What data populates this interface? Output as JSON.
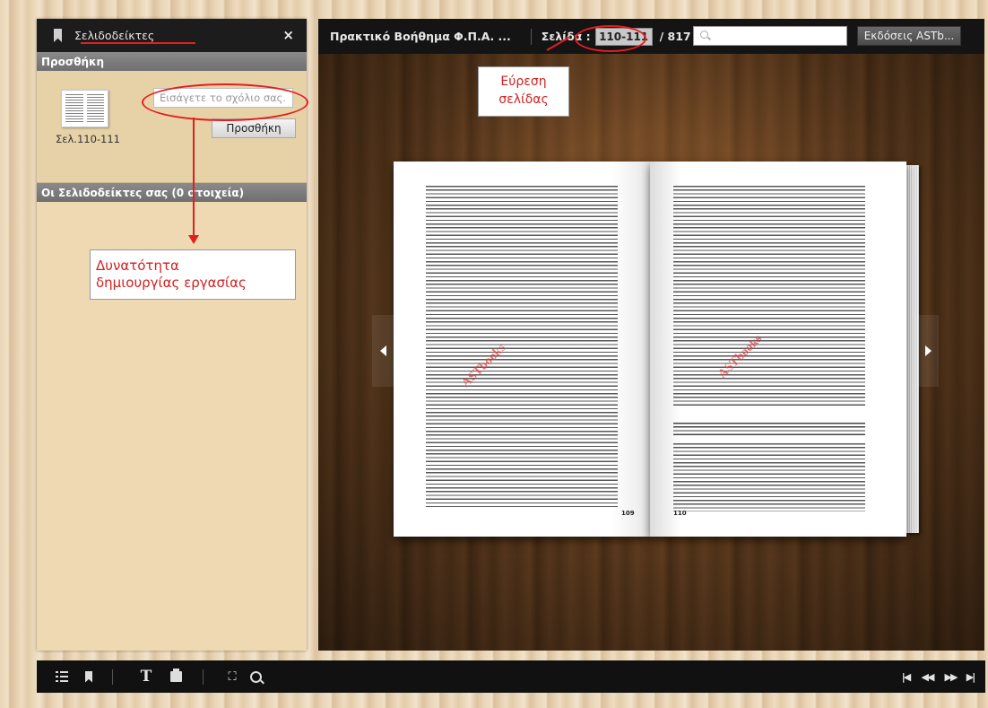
{
  "sidebar": {
    "header_title": "Σελιδοδείκτες",
    "close_glyph": "×",
    "add_section_title": "Προσθήκη",
    "thumbnail_label": "Σελ.110-111",
    "comment_placeholder": "Εισάγετε το σχόλιο σας...",
    "add_button_label": "Προσθήκη",
    "list_section_title": "Οι Σελιδοδείκτες σας (0 στοιχεία)"
  },
  "topbar": {
    "doc_title": "Πρακτικό Βοήθημα Φ.Π.Α. ...",
    "page_label": "Σελίδα :",
    "page_value": "110-111",
    "page_total": "/ 817",
    "editions_button_label": "Εκδόσεις ASTb..."
  },
  "book": {
    "left_page_number": "109",
    "right_page_number": "110",
    "left_heading": "",
    "right_heading": "2.11.2 Διαδικασία εισπραξης του Φ.Π.Α. των επενδυτικών αγαθών των αγροτών του κανονικού καθεστώτος"
  },
  "annotations": {
    "find_page": [
      "Εύρεση",
      "σελίδας"
    ],
    "create_task": [
      "Δυνατότητα",
      "δημιουργίας εργασίας"
    ]
  },
  "icons": {
    "list": "list-icon",
    "bookmark": "bookmark-icon",
    "text": "text-icon",
    "print": "print-icon",
    "fullscreen": "fullscreen-icon",
    "zoom": "zoom-icon",
    "first": "first-page-icon",
    "prev": "previous-page-icon",
    "next": "next-page-icon",
    "last": "last-page-icon"
  },
  "colors": {
    "annotation_red": "#e41e1e",
    "toolbar_dark": "#141414",
    "sidebar_tan": "#eed9b2"
  }
}
